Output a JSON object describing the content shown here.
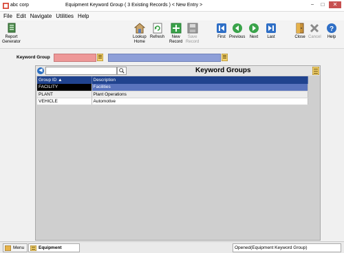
{
  "window": {
    "app_name": "abc corp",
    "title": "Equipment Keyword Group   ( 3 Existing Records )   < New Entry >",
    "minimize": "−",
    "maximize": "□",
    "close": "✕"
  },
  "menu": [
    "File",
    "Edit",
    "Navigate",
    "Utilities",
    "Help"
  ],
  "toolbar": {
    "report_generator": "Report\nGenerator",
    "lookup_home": "Lookup\nHome",
    "refresh": "Refresh",
    "new_record": "New\nRecord",
    "save_record": "Save\nRecord",
    "first": "First",
    "previous": "Previous",
    "next": "Next",
    "last": "Last",
    "close": "Close",
    "cancel": "Cancel",
    "help": "Help"
  },
  "form": {
    "keyword_group_label": "Keyword Group",
    "keyword_group_id": "",
    "keyword_group_desc": ""
  },
  "grid": {
    "title": "Keyword Groups",
    "nav_glyph": "◀",
    "search_value": "",
    "columns": [
      "Group ID ▲",
      "Description"
    ],
    "rows": [
      {
        "id": "FACILITY",
        "desc": "Facilities"
      },
      {
        "id": "PLANT",
        "desc": "Plant Operations"
      },
      {
        "id": "VEHICLE",
        "desc": "Automotive"
      }
    ]
  },
  "statusbar": {
    "menu_tab": "Menu",
    "active_tab": "Equipment Keywor...",
    "message": "Opened(Equipment Keyword Group)"
  },
  "colors": {
    "id_field": "#ee9898",
    "desc_field": "#8e9fd8",
    "grid_header": "#20438e",
    "selected_desc": "#5973bd"
  }
}
